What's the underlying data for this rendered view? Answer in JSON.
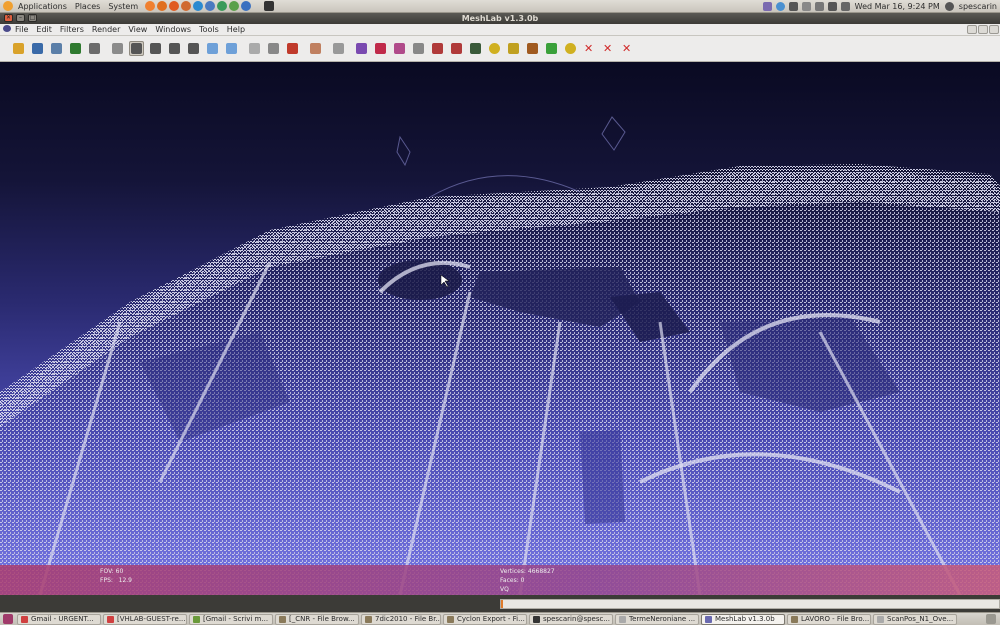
{
  "top_panel": {
    "menus": [
      "Applications",
      "Places",
      "System"
    ],
    "launcher_icons": [
      "ubuntu-icon",
      "vlc-icon",
      "firefox-icon",
      "browser-icon",
      "skype-icon",
      "help-icon",
      "camera-icon",
      "chat-icon",
      "chrome-icon",
      "terminal-icon"
    ],
    "tray": {
      "datetime": "Wed Mar 16,  9:24 PM",
      "user": "spescarin"
    }
  },
  "window": {
    "title": "MeshLab v1.3.0b"
  },
  "menubar": {
    "items": [
      "File",
      "Edit",
      "Filters",
      "Render",
      "View",
      "Windows",
      "Tools",
      "Help"
    ]
  },
  "toolbar": {
    "buttons": [
      {
        "name": "open-icon",
        "color": "#d9a22a"
      },
      {
        "name": "reload-icon",
        "color": "#3a6aa8"
      },
      {
        "name": "save-snapshot-icon",
        "color": "#5b7fa8"
      },
      {
        "name": "save-icon",
        "color": "#2f7a2f"
      },
      {
        "name": "layers-icon",
        "color": "#6b6b6b"
      },
      {
        "name": "bbox-icon",
        "color": "#8b8b8b"
      },
      {
        "name": "points-icon",
        "color": "#555555"
      },
      {
        "name": "wireframe-icon",
        "color": "#555555"
      },
      {
        "name": "hidden-lines-icon",
        "color": "#555555"
      },
      {
        "name": "flat-lines-icon",
        "color": "#555555"
      },
      {
        "name": "flat-icon",
        "color": "#6ea0d8"
      },
      {
        "name": "smooth-icon",
        "color": "#6ea0d8"
      },
      {
        "name": "texture-icon",
        "color": "#aaaaaa"
      },
      {
        "name": "light-icon",
        "color": "#888888"
      },
      {
        "name": "back-face-icon",
        "color": "#c03a2b"
      },
      {
        "name": "color-icon",
        "color": "#c08060"
      },
      {
        "name": "pointer-icon",
        "color": "#999999"
      },
      {
        "name": "select-vertex-icon",
        "color": "#7a4ab0"
      },
      {
        "name": "paint-icon",
        "color": "#c02a4a"
      },
      {
        "name": "select-faces-icon",
        "color": "#b04a8a"
      },
      {
        "name": "move-icon",
        "color": "#888888"
      },
      {
        "name": "measure-icon",
        "color": "#b03a3a"
      },
      {
        "name": "align-icon",
        "color": "#b03a3a"
      },
      {
        "name": "raster-icon",
        "color": "#3a5a3a"
      },
      {
        "name": "annotate-icon",
        "color": "#d0b020"
      },
      {
        "name": "brush-icon",
        "color": "#c0a020"
      },
      {
        "name": "pencil-icon",
        "color": "#a05a20"
      },
      {
        "name": "points-pick-icon",
        "color": "#3aa03a"
      },
      {
        "name": "info-icon",
        "color": "#d0b020"
      },
      {
        "name": "delete-vertices-icon",
        "color": "#d02a2a"
      },
      {
        "name": "delete-faces-icon",
        "color": "#d02a2a"
      },
      {
        "name": "delete-selected-icon",
        "color": "#d02a2a"
      }
    ]
  },
  "viewport_info": {
    "fov_label": "FOV:",
    "fov_value": "60",
    "fps_label": "FPS:",
    "fps_value": "12.9",
    "vertices_label": "Vertices:",
    "vertices_value": "4668827",
    "faces_label": "Faces:",
    "faces_value": "0",
    "mode": "VQ"
  },
  "progress": {
    "fraction": 0.004
  },
  "taskbar": {
    "items": [
      {
        "label": "Gmail - URGENT...",
        "color": "#d04040",
        "active": false
      },
      {
        "label": "[VHLAB-GUEST-re...",
        "color": "#d04040",
        "active": false
      },
      {
        "label": "[Gmail - Scrivi m...",
        "color": "#6a9a3a",
        "active": false
      },
      {
        "label": "[_CNR - File Brow...",
        "color": "#8a7a5a",
        "active": false
      },
      {
        "label": "7dic2010 - File Br...",
        "color": "#8a7a5a",
        "active": false
      },
      {
        "label": "Cyclon Export - Fi...",
        "color": "#8a7a5a",
        "active": false
      },
      {
        "label": "spescarin@spesc...",
        "color": "#333333",
        "active": false
      },
      {
        "label": "TermeNeroniane ...",
        "color": "#aaaaaa",
        "active": false
      },
      {
        "label": "MeshLab v1.3.0b",
        "color": "#6a6ab0",
        "active": true
      },
      {
        "label": "LAVORO - File Bro...",
        "color": "#8a7a5a",
        "active": false
      },
      {
        "label": "ScanPos_N1_Ove...",
        "color": "#aaaaaa",
        "active": false
      }
    ]
  }
}
